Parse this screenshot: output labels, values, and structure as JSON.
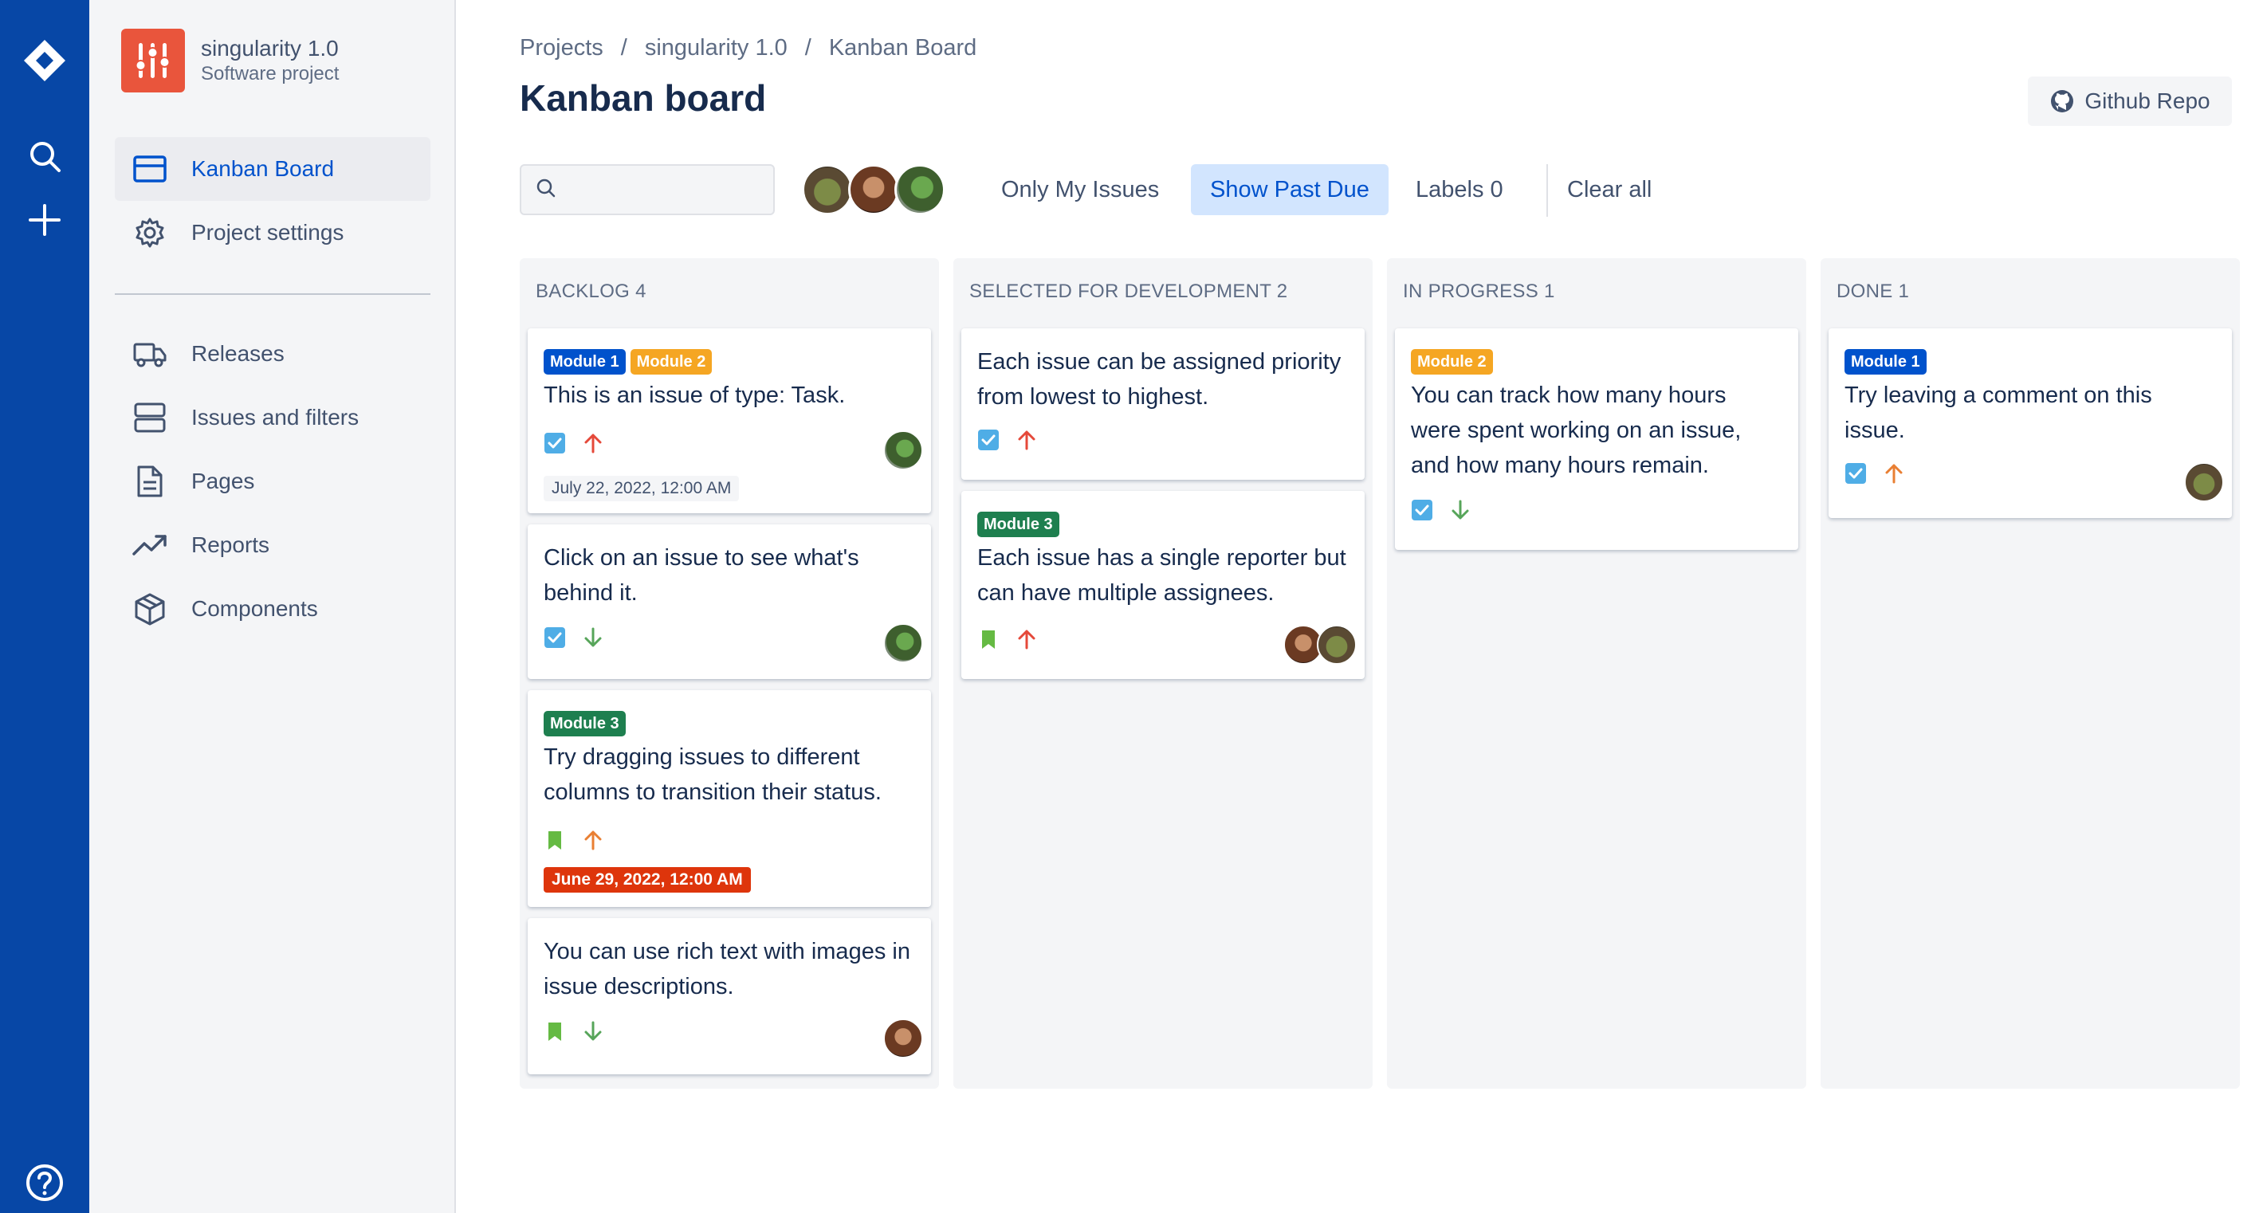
{
  "project": {
    "name": "singularity 1.0",
    "type": "Software project"
  },
  "sidebar": {
    "items": [
      {
        "label": "Kanban Board",
        "icon": "board-icon",
        "active": true
      },
      {
        "label": "Project settings",
        "icon": "gear-icon",
        "active": false
      },
      {
        "label": "Releases",
        "icon": "truck-icon",
        "active": false
      },
      {
        "label": "Issues and filters",
        "icon": "stack-icon",
        "active": false
      },
      {
        "label": "Pages",
        "icon": "page-icon",
        "active": false
      },
      {
        "label": "Reports",
        "icon": "trend-icon",
        "active": false
      },
      {
        "label": "Components",
        "icon": "box-icon",
        "active": false
      }
    ]
  },
  "breadcrumb": [
    "Projects",
    "/",
    "singularity 1.0",
    "/",
    "Kanban Board"
  ],
  "page_title": "Kanban board",
  "github_label": "Github Repo",
  "search": {
    "value": "",
    "placeholder": ""
  },
  "filters": {
    "only_mine": "Only My Issues",
    "past_due": "Show Past Due",
    "labels": "Labels 0",
    "clear": "Clear all"
  },
  "columns": [
    {
      "title": "BACKLOG 4",
      "cards": [
        {
          "tags": [
            "Module 1",
            "Module 2"
          ],
          "title": "This is an issue of type: Task.",
          "type": "task",
          "priority": "high",
          "due": "July 22, 2022, 12:00 AM",
          "due_state": "ok"
        },
        {
          "tags": [],
          "title": "Click on an issue to see what's behind it.",
          "type": "task",
          "priority": "low",
          "due": "",
          "due_state": ""
        },
        {
          "tags": [
            "Module 3"
          ],
          "title": "Try dragging issues to different columns to transition their status.",
          "type": "story",
          "priority": "medium",
          "due": "June 29, 2022, 12:00 AM",
          "due_state": "late"
        },
        {
          "tags": [],
          "title": "You can use rich text with images in issue descriptions.",
          "type": "story",
          "priority": "low",
          "due": "",
          "due_state": ""
        }
      ]
    },
    {
      "title": "SELECTED FOR DEVELOPMENT 2",
      "cards": [
        {
          "tags": [],
          "title": "Each issue can be assigned priority from lowest to highest.",
          "type": "task",
          "priority": "high"
        },
        {
          "tags": [
            "Module 3"
          ],
          "title": "Each issue has a single reporter but can have multiple assignees.",
          "type": "story",
          "priority": "high"
        }
      ]
    },
    {
      "title": "IN PROGRESS 1",
      "cards": [
        {
          "tags": [
            "Module 2"
          ],
          "title": "You can track how many hours were spent working on an issue, and how many hours remain.",
          "type": "task",
          "priority": "low"
        }
      ]
    },
    {
      "title": "DONE 1",
      "cards": [
        {
          "tags": [
            "Module 1"
          ],
          "title": "Try leaving a comment on this issue.",
          "type": "task",
          "priority": "medium"
        }
      ]
    }
  ],
  "colors": {
    "rail": "#0747a6",
    "accent": "#0052cc",
    "priority_high": "#e5493a",
    "priority_medium": "#e97f33",
    "priority_low": "#57a55a",
    "task_icon": "#4fade6",
    "story_icon": "#65ba43"
  }
}
